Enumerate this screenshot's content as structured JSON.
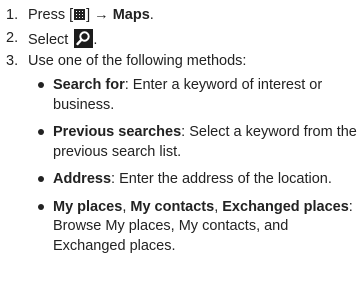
{
  "steps": [
    {
      "num": "1.",
      "prefix": "Press [",
      "suffix": "] →",
      "target": "Maps",
      "end": "."
    },
    {
      "num": "2.",
      "prefix": "Select",
      "end": "."
    },
    {
      "num": "3.",
      "text": "Use one of the following methods:"
    }
  ],
  "methods": [
    {
      "label": "Search for",
      "text": ": Enter a keyword of interest or business."
    },
    {
      "label": "Previous searches",
      "text": ": Select a keyword from the previous search list."
    },
    {
      "label": "Address",
      "text": ": Enter the address of the location."
    },
    {
      "label": "My places",
      "sep1": ", ",
      "label2": "My contacts",
      "sep2": ", ",
      "label3": "Exchanged places",
      "text": ": Browse My places, My contacts, and Exchanged places."
    }
  ],
  "icons": {
    "menu_key": "menu-key-icon",
    "search_button": "search-icon"
  }
}
